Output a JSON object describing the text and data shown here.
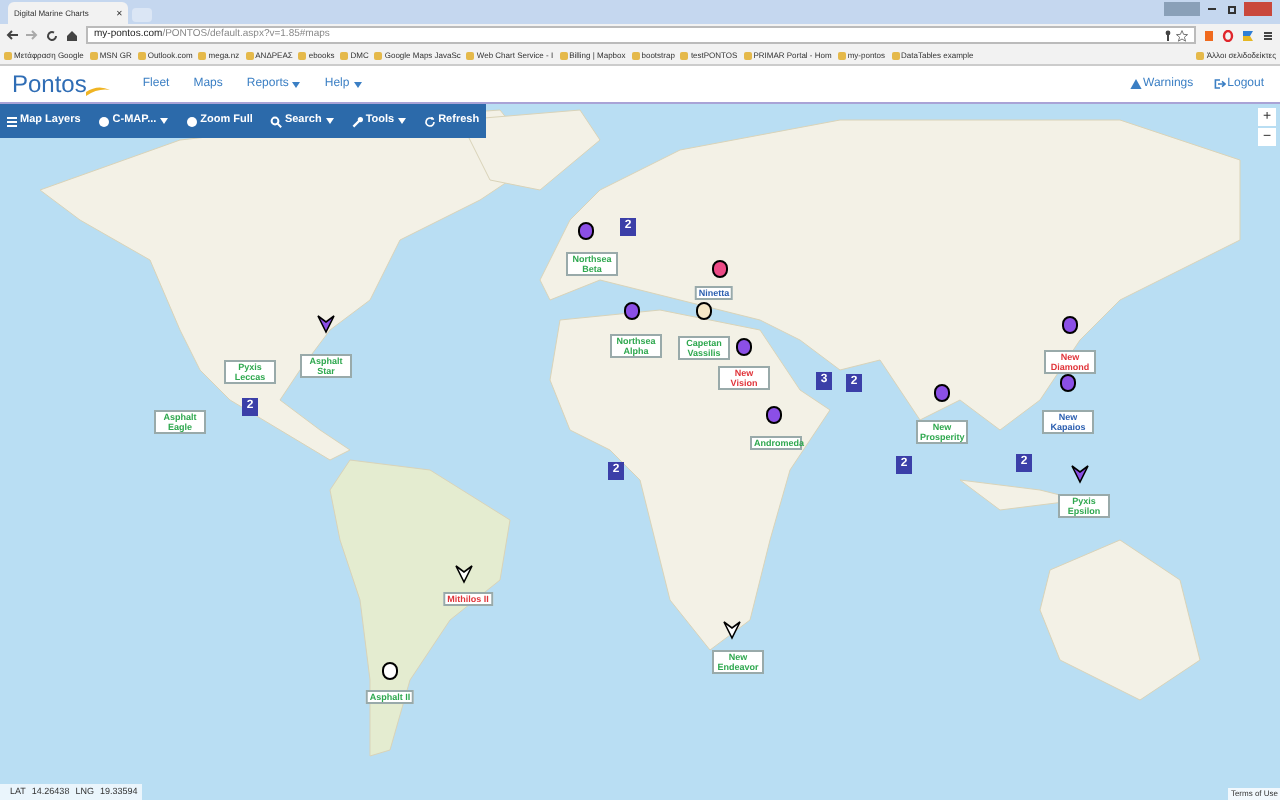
{
  "browser": {
    "tab_title": "Digital Marine Charts",
    "tab_close": "✕",
    "address_host": "my-pontos.com",
    "address_path": "/PONTOS/default.aspx?v=1.85#maps",
    "bookmarks": [
      "Μετάφραση Google",
      "MSN GR",
      "Outlook.com",
      "mega.nz",
      "ΑΝΔΡΕΑΣ",
      "ebooks",
      "DMC",
      "Google Maps JavaSc",
      "Web Chart Service - I",
      "Billing | Mapbox",
      "bootstrap",
      "testPONTOS",
      "PRIMAR Portal - Hom",
      "my-pontos",
      "DataTables example"
    ],
    "other_bookmarks": "Άλλοι σελιδοδείκτες"
  },
  "app": {
    "logo": "Pontos",
    "nav": [
      {
        "label": "Fleet",
        "dropdown": false
      },
      {
        "label": "Maps",
        "dropdown": false
      },
      {
        "label": "Reports",
        "dropdown": true
      },
      {
        "label": "Help",
        "dropdown": true
      }
    ],
    "right_links": [
      {
        "label": "Warnings",
        "kind": "warning"
      },
      {
        "label": "Logout",
        "kind": "logout"
      }
    ],
    "toolbar": [
      {
        "label": "Map Layers",
        "kind": "layers",
        "dropdown": false
      },
      {
        "label": "C-MAP...",
        "kind": "globe",
        "dropdown": true
      },
      {
        "label": "Zoom Full",
        "kind": "globe",
        "dropdown": false
      },
      {
        "label": "Search",
        "kind": "search",
        "dropdown": true
      },
      {
        "label": "Tools",
        "kind": "wrench",
        "dropdown": true
      },
      {
        "label": "Refresh",
        "kind": "refresh",
        "dropdown": false
      }
    ]
  },
  "map": {
    "zoom_in": "+",
    "zoom_out": "−",
    "vessels": [
      {
        "kind": "dot",
        "color": "#8b4fe6",
        "label": {
          "text": "Northsea Beta",
          "color": "#2fa84f"
        }
      },
      {
        "kind": "dot",
        "color": "#ec4b86",
        "label": {
          "text": "Ninetta",
          "color": "#2c5fb0"
        }
      },
      {
        "kind": "dot",
        "color": "#8b4fe6",
        "label": {
          "text": "Northsea Alpha",
          "color": "#2fa84f"
        }
      },
      {
        "kind": "dot",
        "color": "#f6e7c6",
        "label": {
          "text": "Capetan Vassilis",
          "color": "#2fa84f"
        }
      },
      {
        "kind": "dot",
        "color": "#8b4fe6",
        "label": {
          "text": "New Vision",
          "color": "#e0343a"
        }
      },
      {
        "kind": "dot",
        "color": "#8b4fe6",
        "label": {
          "text": "Andromeda",
          "color": "#2fa84f"
        }
      },
      {
        "kind": "dot",
        "color": "#8b4fe6",
        "label": {
          "text": "New Prosperity",
          "color": "#2fa84f"
        }
      },
      {
        "kind": "dot",
        "color": "#8b4fe6",
        "label": {
          "text": "New Diamond",
          "color": "#e0343a"
        }
      },
      {
        "kind": "dot",
        "color": "#8b4fe6",
        "label": {
          "text": "New Kapaios",
          "color": "#2c5fb0"
        }
      },
      {
        "kind": "arrow",
        "color": "#8b4fe6",
        "label": {
          "text": "Pyxis Epsilon",
          "color": "#2fa84f"
        }
      },
      {
        "kind": "arrow",
        "color": "#8b4fe6",
        "label": {
          "text": "Asphalt Star",
          "color": "#2fa84f"
        }
      },
      {
        "kind": "none",
        "label": {
          "text": "Pyxis Leccas",
          "color": "#2fa84f"
        }
      },
      {
        "kind": "none",
        "label": {
          "text": "Asphalt Eagle",
          "color": "#2fa84f"
        }
      },
      {
        "kind": "arrow",
        "color": "#ffffff",
        "label": {
          "text": "Mithilos II",
          "color": "#e0343a"
        }
      },
      {
        "kind": "dot",
        "color": "#ffffff",
        "label": {
          "text": "Asphalt II",
          "color": "#2fa84f"
        }
      },
      {
        "kind": "arrow",
        "color": "#ffffff",
        "label": {
          "text": "New Endeavor",
          "color": "#2fa84f"
        }
      }
    ],
    "clusters": [
      {
        "count": "2"
      },
      {
        "count": "2"
      },
      {
        "count": "2"
      },
      {
        "count": "3"
      },
      {
        "count": "2"
      },
      {
        "count": "2"
      },
      {
        "count": "2"
      }
    ],
    "terms": "Terms of Use"
  },
  "status_bar": {
    "lat_label": "LAT",
    "lat": "14.26438",
    "lng_label": "LNG",
    "lng": "19.33594"
  }
}
